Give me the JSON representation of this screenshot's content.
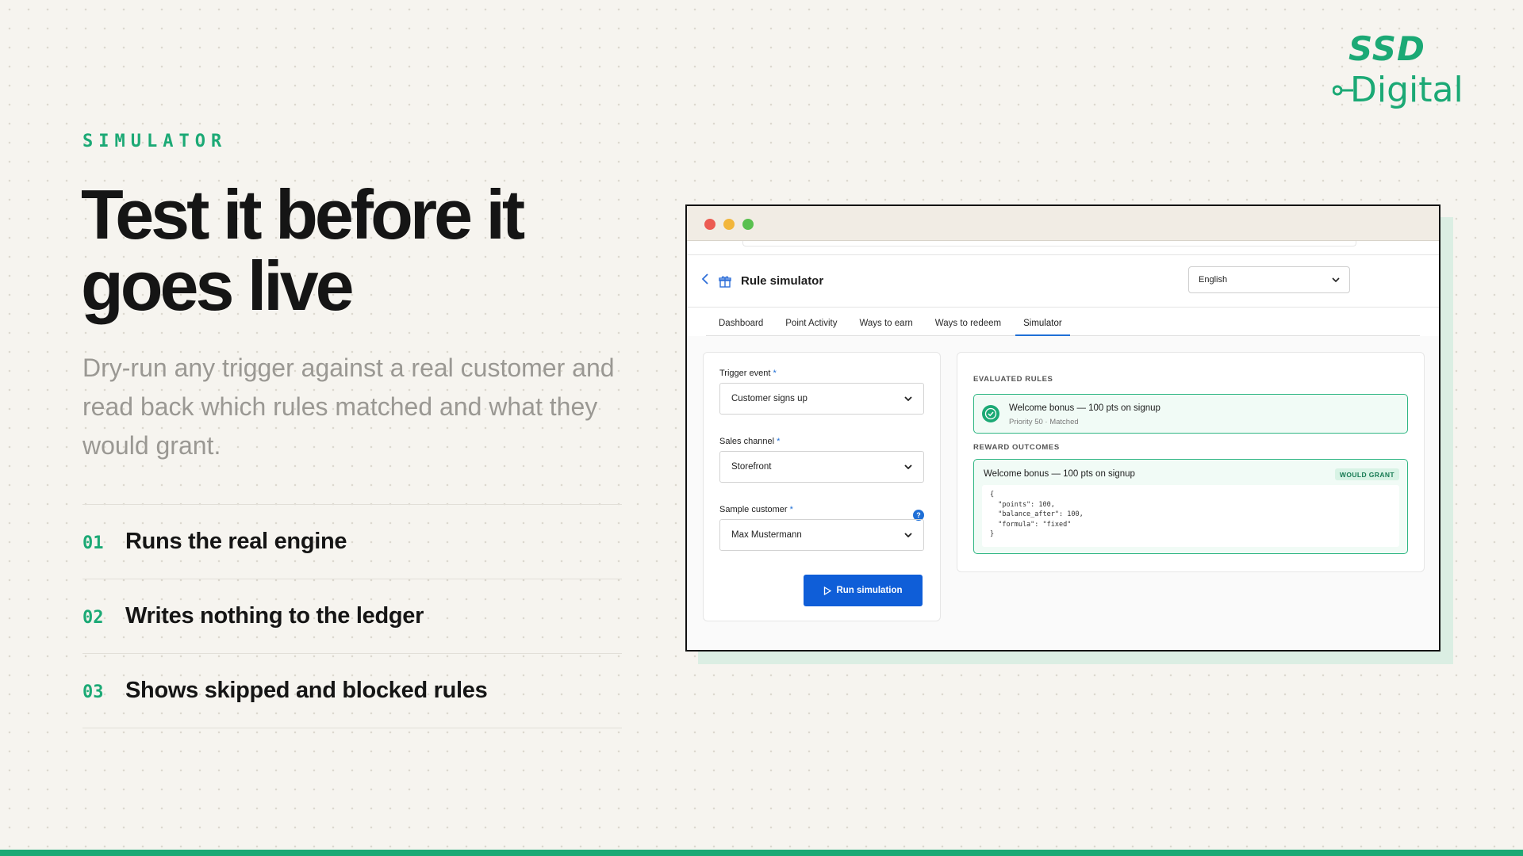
{
  "brand": {
    "logo_top": "SSD",
    "logo_bottom": "Digital",
    "accent_color": "#1ba975"
  },
  "hero": {
    "eyebrow": "SIMULATOR",
    "headline": "Test it before it goes live",
    "subhead": "Dry-run any trigger against a real customer and read back which rules matched and what they would grant."
  },
  "features": [
    {
      "num": "01",
      "text": "Runs the real engine"
    },
    {
      "num": "02",
      "text": "Writes nothing to the ledger"
    },
    {
      "num": "03",
      "text": "Shows skipped and blocked rules"
    }
  ],
  "app": {
    "page_title": "Rule simulator",
    "language": "English",
    "tabs": [
      "Dashboard",
      "Point Activity",
      "Ways to earn",
      "Ways to redeem",
      "Simulator"
    ],
    "active_tab": "Simulator",
    "form": {
      "trigger_label": "Trigger event",
      "trigger_value": "Customer signs up",
      "channel_label": "Sales channel",
      "channel_value": "Storefront",
      "customer_label": "Sample customer",
      "customer_value": "Max Mustermann",
      "required_mark": "*",
      "info_glyph": "?",
      "run_button": "Run simulation"
    },
    "results": {
      "evaluated_label": "EVALUATED RULES",
      "rule_title": "Welcome bonus — 100 pts on signup",
      "rule_meta": "Priority 50 · Matched",
      "outcomes_label": "REWARD OUTCOMES",
      "outcome_title": "Welcome bonus — 100 pts on signup",
      "outcome_badge": "WOULD GRANT",
      "outcome_json": "{\n  \"points\": 100,\n  \"balance_after\": 100,\n  \"formula\": \"fixed\"\n}"
    }
  },
  "icons": {
    "back": "chevron-left-icon",
    "gift": "gift-icon",
    "check": "check-circle-icon",
    "play": "play-icon",
    "info": "info-icon",
    "chevron": "chevron-down-icon"
  }
}
